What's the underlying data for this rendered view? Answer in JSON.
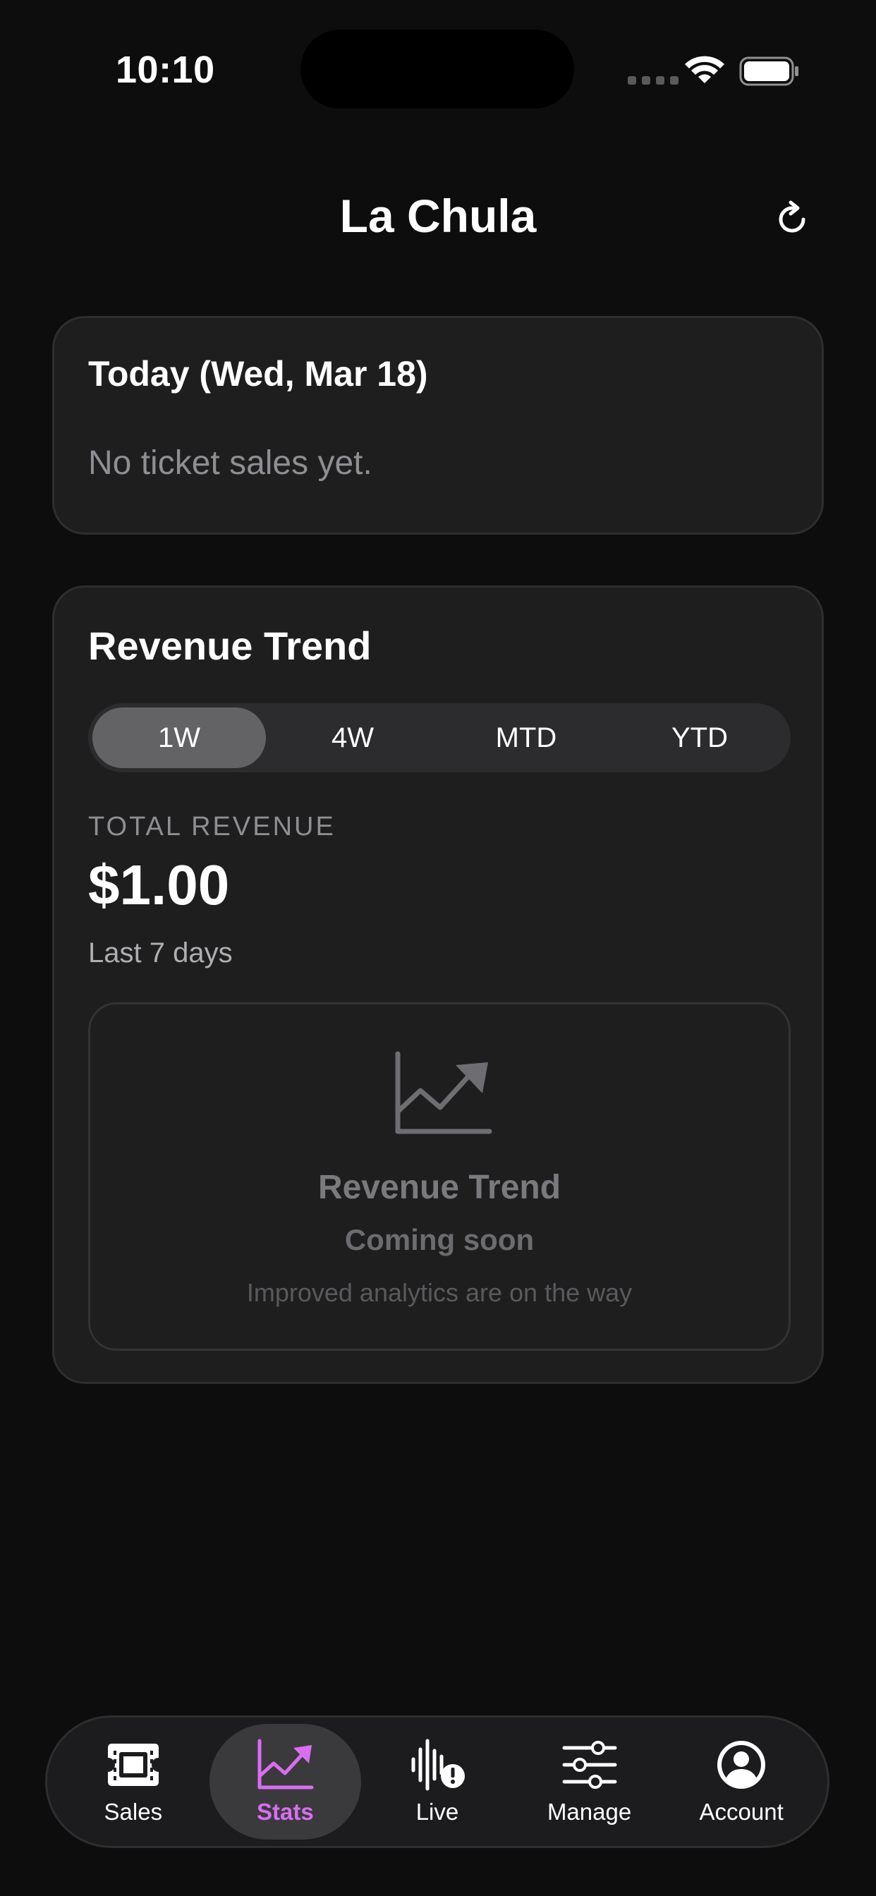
{
  "status_bar": {
    "time": "10:10"
  },
  "header": {
    "title": "La Chula"
  },
  "today": {
    "title": "Today (Wed, Mar 18)",
    "empty_message": "No ticket sales yet."
  },
  "revenue": {
    "title": "Revenue Trend",
    "ranges": [
      "1W",
      "4W",
      "MTD",
      "YTD"
    ],
    "selected_range": "1W",
    "total_label": "TOTAL REVENUE",
    "total_value": "$1.00",
    "period_label": "Last 7 days",
    "placeholder": {
      "icon": "chart-line-up-icon",
      "title": "Revenue Trend",
      "subtitle": "Coming soon",
      "note": "Improved analytics are on the way"
    }
  },
  "tabs": [
    {
      "label": "Sales",
      "icon": "ticket-icon"
    },
    {
      "label": "Stats",
      "icon": "chart-icon",
      "active": true
    },
    {
      "label": "Live",
      "icon": "waveform-alert-icon"
    },
    {
      "label": "Manage",
      "icon": "sliders-icon"
    },
    {
      "label": "Account",
      "icon": "person-circle-icon"
    }
  ],
  "colors": {
    "accent": "#d86ef2",
    "background": "#0d0d0d",
    "card": "#1e1e1e"
  }
}
